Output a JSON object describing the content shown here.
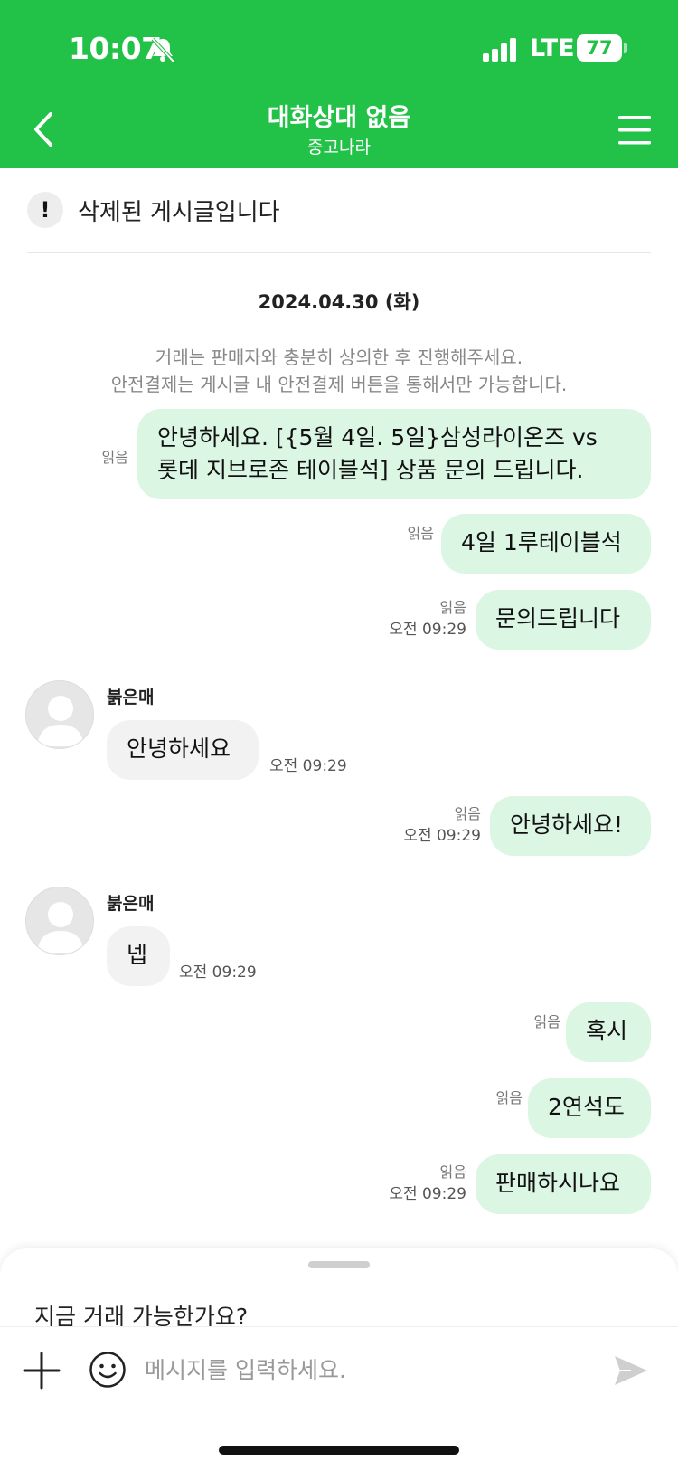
{
  "status_bar": {
    "time": "10:07",
    "network": "LTE",
    "battery": "77"
  },
  "header": {
    "title": "대화상대 없음",
    "subtitle": "중고나라",
    "back_icon": "chevron-left-icon",
    "menu_icon": "hamburger-icon"
  },
  "notice": {
    "text": "삭제된 게시글입니다",
    "icon": "exclamation-icon"
  },
  "date": "2024.04.30 (화)",
  "info": {
    "line1": "거래는 판매자와 충분히 상의한 후 진행해주세요.",
    "line2": "안전결제는 게시글 내 안전결제 버튼을 통해서만 가능합니다."
  },
  "messages": [
    {
      "side": "mine",
      "line1": "안녕하세요. [{5월 4일.  5일}삼성라이온즈 vs",
      "line2": "롯데 지브로존 테이블석] 상품 문의 드립니다.",
      "read": "읽음",
      "time": ""
    },
    {
      "side": "mine",
      "text": "4일 1루테이블석",
      "read": "읽음",
      "time": ""
    },
    {
      "side": "mine",
      "text": "문의드립니다",
      "read": "읽음",
      "time": "오전 09:29"
    },
    {
      "side": "theirs",
      "sender": "붉은매",
      "text": "안녕하세요",
      "time": "오전 09:29"
    },
    {
      "side": "mine",
      "text": "안녕하세요!",
      "read": "읽음",
      "time": "오전 09:29"
    },
    {
      "side": "theirs",
      "sender": "붉은매",
      "text": "넵",
      "time": "오전 09:29"
    },
    {
      "side": "mine",
      "text": "혹시",
      "read": "읽음",
      "time": ""
    },
    {
      "side": "mine",
      "text": "2연석도",
      "read": "읽음",
      "time": ""
    },
    {
      "side": "mine",
      "text": "판매하시나요",
      "read": "읽음",
      "time": "오전 09:29"
    }
  ],
  "bottom_sheet": {
    "suggestion": "지금 거래 가능한가요?",
    "input_placeholder": "메시지를 입력하세요.",
    "input_value": ""
  },
  "colors": {
    "brand_green": "#22c147",
    "my_bubble": "#dcf6e4",
    "their_bubble": "#f2f2f2"
  }
}
